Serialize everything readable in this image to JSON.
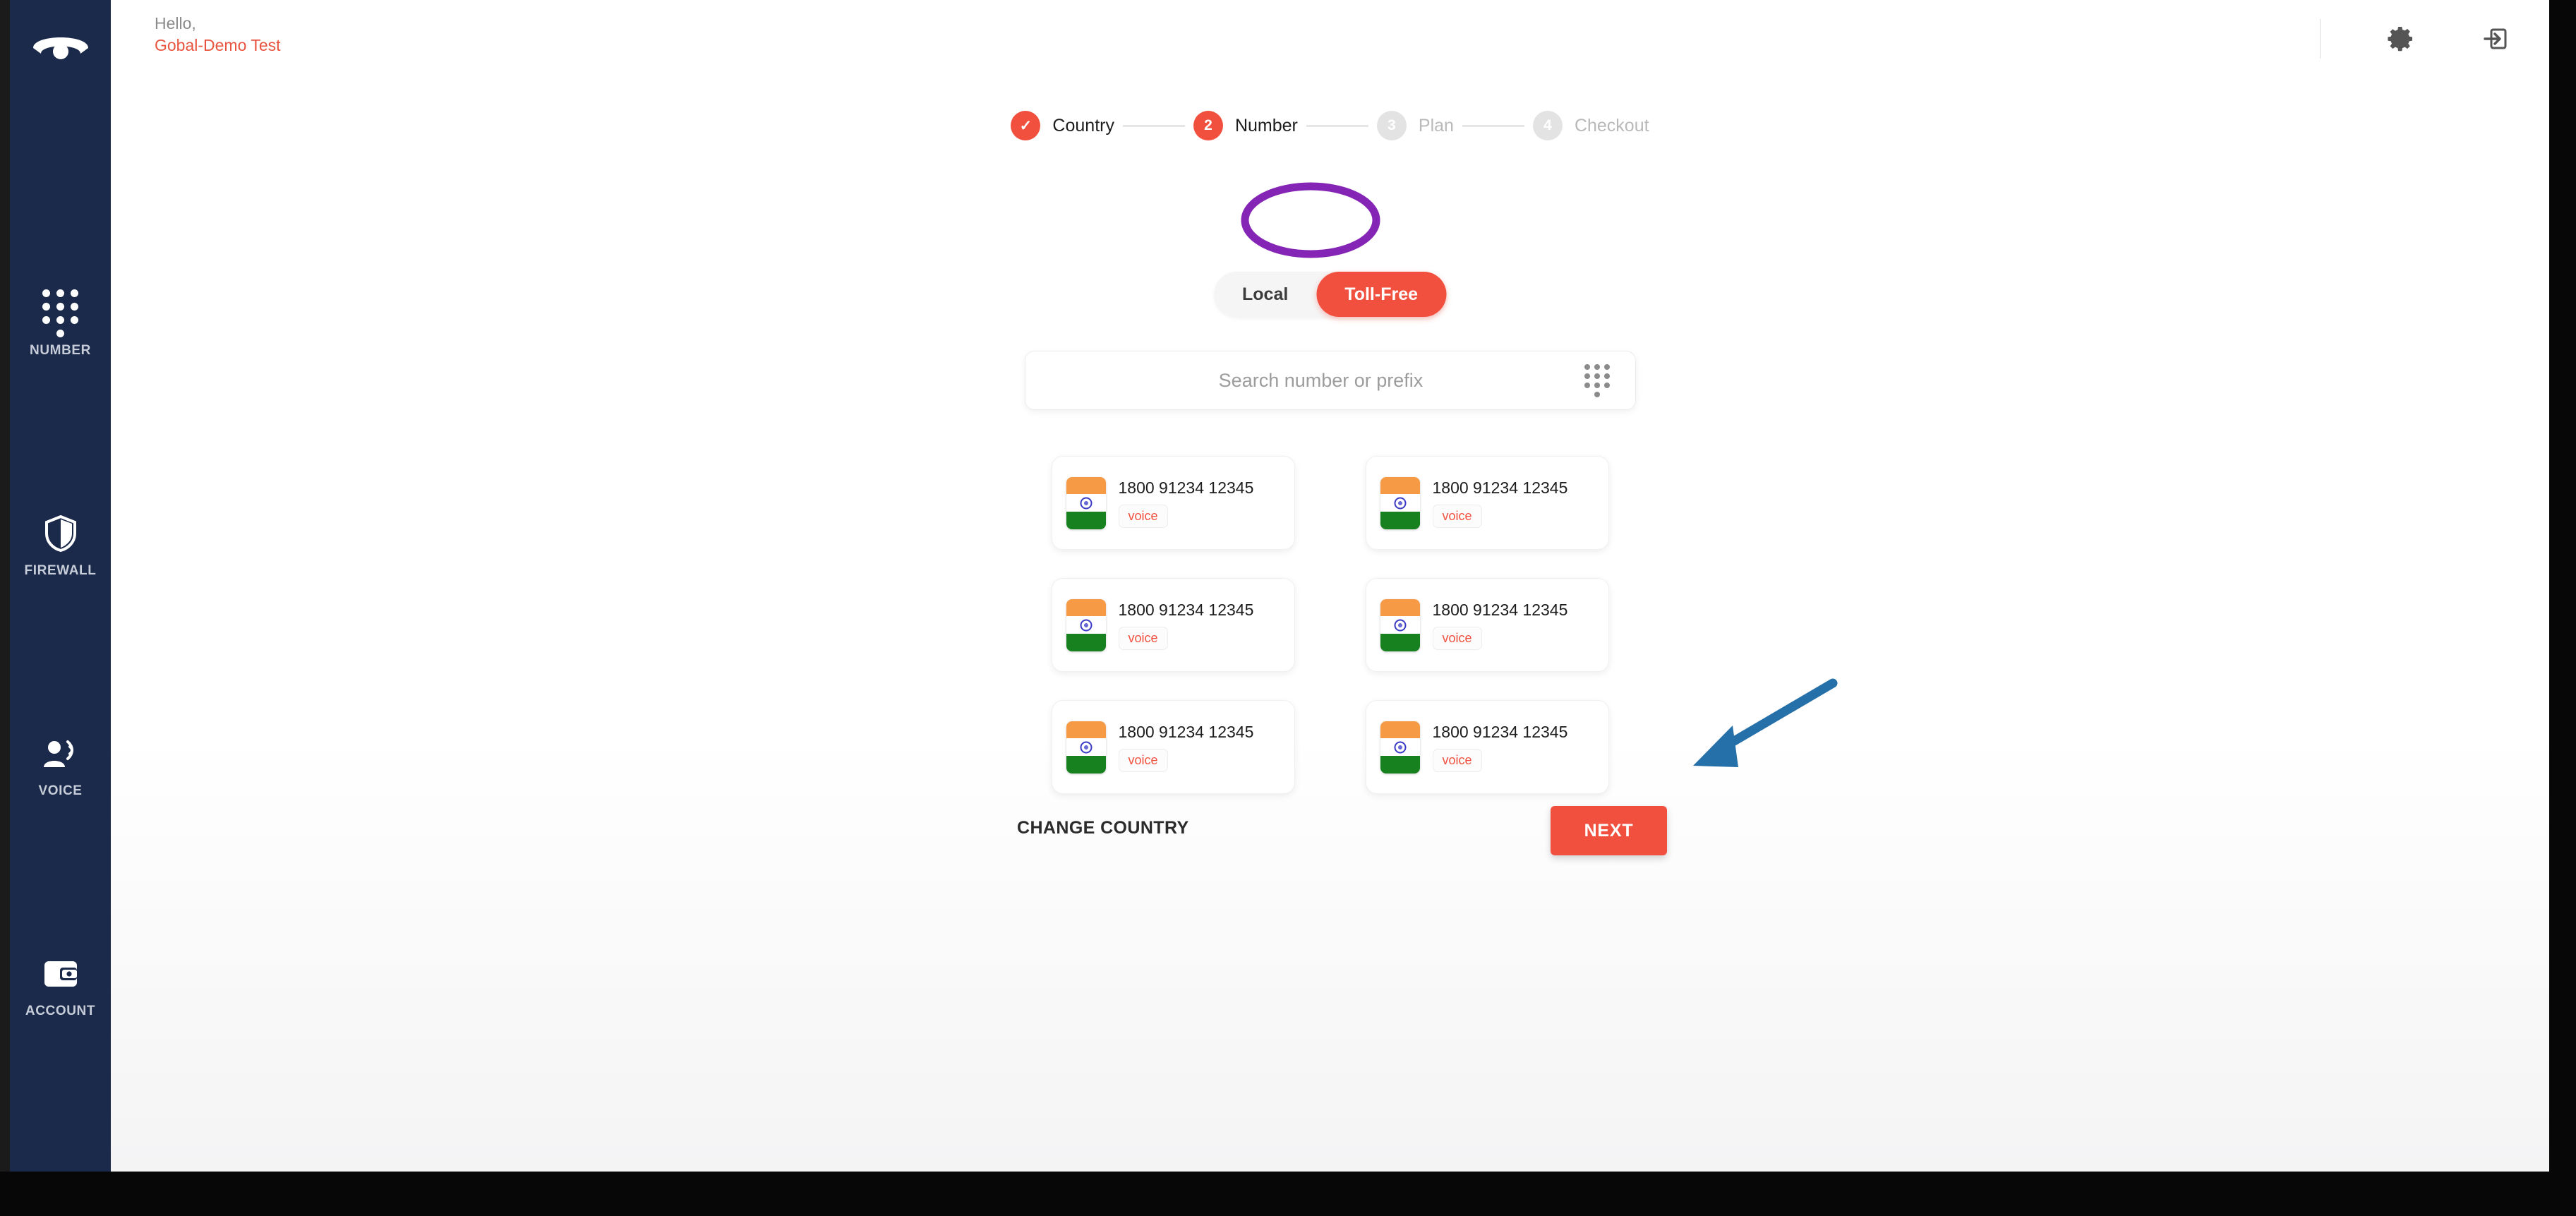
{
  "header": {
    "greeting": "Hello,",
    "username": "Gobal-Demo Test",
    "settings_icon": "gear-icon",
    "logout_icon": "logout-icon"
  },
  "sidebar": {
    "logo_icon": "phone-receiver-icon",
    "items": [
      {
        "label": "NUMBER",
        "icon": "dialpad-icon"
      },
      {
        "label": "FIREWALL",
        "icon": "shield-icon"
      },
      {
        "label": "VOICE",
        "icon": "person-speaking-icon"
      },
      {
        "label": "ACCOUNT",
        "icon": "wallet-icon"
      }
    ]
  },
  "stepper": {
    "steps": [
      {
        "marker": "✓",
        "label": "Country",
        "state": "done"
      },
      {
        "marker": "2",
        "label": "Number",
        "state": "active"
      },
      {
        "marker": "3",
        "label": "Plan",
        "state": "todo"
      },
      {
        "marker": "4",
        "label": "Checkout",
        "state": "todo"
      }
    ]
  },
  "number_type_toggle": {
    "options": [
      {
        "label": "Local",
        "selected": false
      },
      {
        "label": "Toll-Free",
        "selected": true
      }
    ]
  },
  "search": {
    "placeholder": "Search number or prefix",
    "value": "",
    "trailing_icon": "dialpad-icon"
  },
  "number_list": [
    {
      "number": "1800 91234 12345",
      "tag": "voice",
      "country": "India"
    },
    {
      "number": "1800 91234 12345",
      "tag": "voice",
      "country": "India"
    },
    {
      "number": "1800 91234 12345",
      "tag": "voice",
      "country": "India"
    },
    {
      "number": "1800 91234 12345",
      "tag": "voice",
      "country": "India"
    },
    {
      "number": "1800 91234 12345",
      "tag": "voice",
      "country": "India"
    },
    {
      "number": "1800 91234 12345",
      "tag": "voice",
      "country": "India"
    }
  ],
  "footer": {
    "change_country_label": "CHANGE COUNTRY",
    "next_label": "NEXT"
  },
  "annotations": {
    "highlight_ellipse_target": "Toll-Free",
    "arrow_target": "NEXT",
    "ellipse_color": "#8425b5",
    "arrow_color": "#2570a8"
  },
  "colors": {
    "accent": "#f2503e",
    "sidebar": "#1b2a4a",
    "username": "#e8543f",
    "tag": "#f2503e"
  }
}
